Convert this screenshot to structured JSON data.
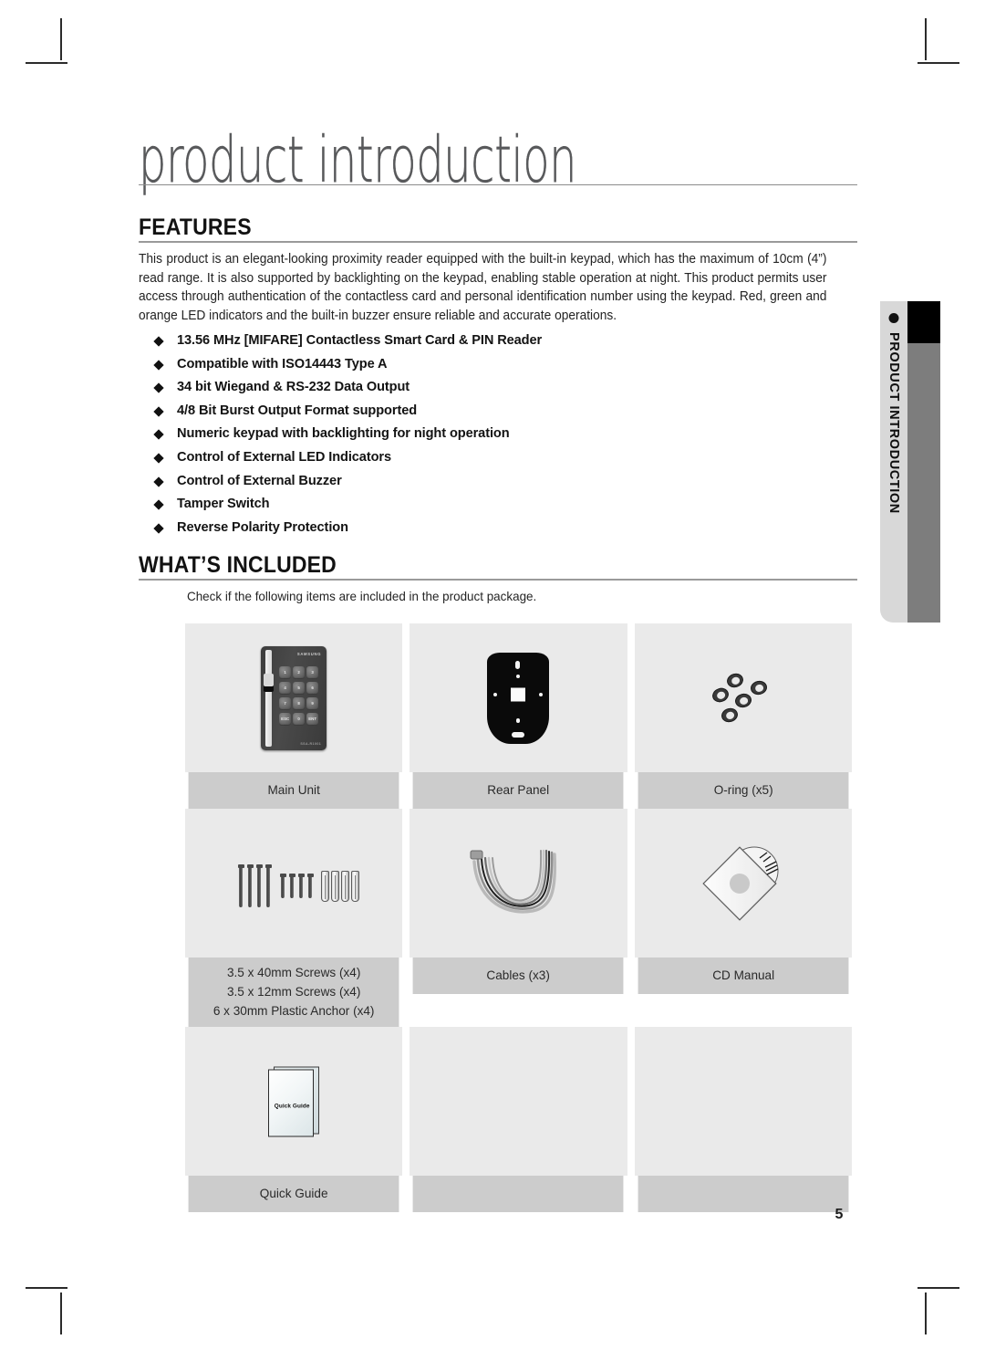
{
  "document": {
    "chapter_title": "product introduction",
    "page_number": "5",
    "side_tab": {
      "label": "PRODUCT INTRODUCTION"
    }
  },
  "features": {
    "heading": "FEATURES",
    "paragraph": "This product is an elegant-looking proximity reader equipped with the built-in keypad, which has the maximum of 10cm (4”) read range. It is also supported by backlighting on the keypad, enabling stable operation at night. This product permits user access through authentication of the contactless card and personal identification number  using the keypad. Red, green and orange LED indicators and the built-in buzzer ensure reliable and accurate operations.",
    "bullets": [
      "13.56 MHz [MIFARE] Contactless Smart Card & PIN Reader",
      "Compatible with ISO14443 Type A",
      "34 bit Wiegand & RS-232 Data Output",
      "4/8 Bit Burst Output Format supported",
      "Numeric keypad with backlighting for night operation",
      "Control of External LED Indicators",
      "Control of External Buzzer",
      "Tamper Switch",
      "Reverse Polarity Protection"
    ]
  },
  "whats_included": {
    "heading": "WHAT’S INCLUDED",
    "note": "Check if the following items are included in the product package.",
    "items": [
      {
        "caption": "Main Unit",
        "art": "reader"
      },
      {
        "caption": "Rear Panel",
        "art": "rear-panel"
      },
      {
        "caption": "O-ring (x5)",
        "art": "orings"
      },
      {
        "caption_lines": [
          "3.5 x 40mm Screws (x4)",
          "3.5 x 12mm Screws (x4)",
          "6 x 30mm Plastic Anchor (x4)"
        ],
        "art": "screws"
      },
      {
        "caption": "Cables (x3)",
        "art": "cables"
      },
      {
        "caption": "CD Manual",
        "art": "cd"
      },
      {
        "caption": "Quick Guide",
        "art": "booklet"
      },
      {
        "caption": "",
        "art": "blank"
      },
      {
        "caption": "",
        "art": "blank"
      }
    ]
  },
  "illustrations": {
    "main_unit": {
      "brand": "SAMSUNG",
      "model": "SSA-R1001",
      "keys": [
        "1",
        "2",
        "3",
        "4",
        "5",
        "6",
        "7",
        "8",
        "9",
        "ESC",
        "0",
        "ENT"
      ]
    },
    "booklet": {
      "label": "Quick Guide"
    }
  },
  "colors": {
    "cell_background": "#eaeaea",
    "caption_background": "#cccccc",
    "side_tab": "#d8d8d8",
    "side_bar": "#7d7d7d",
    "rule": "#9a9a9a",
    "title_text": "#58595b"
  }
}
